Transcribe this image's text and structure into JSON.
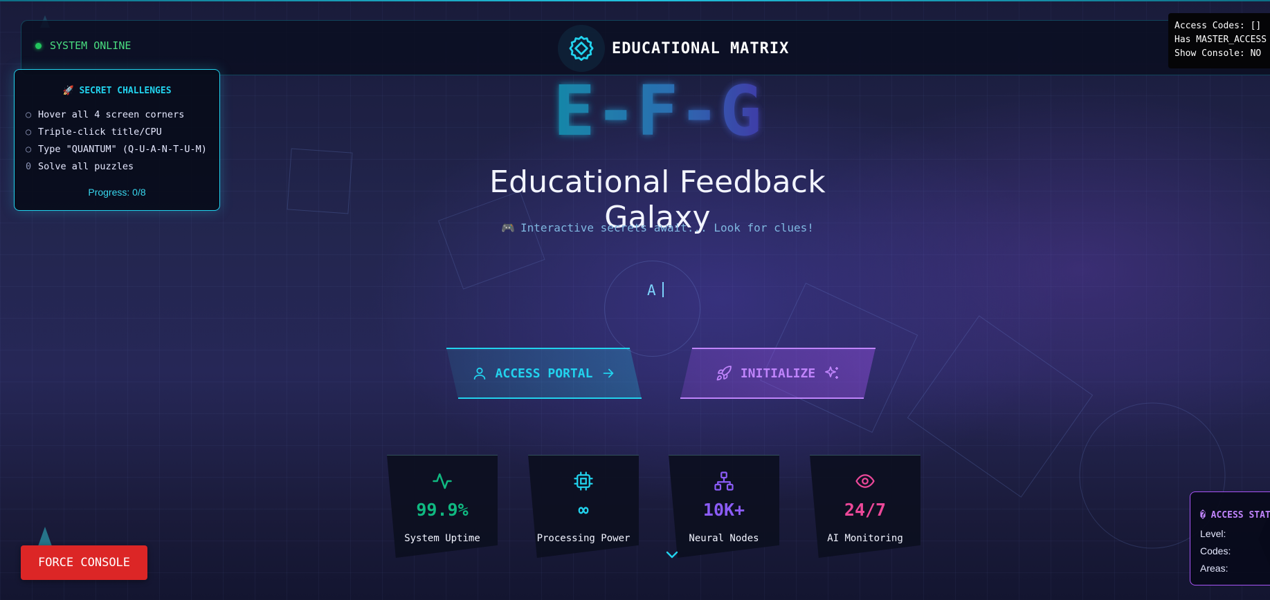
{
  "header": {
    "status_text": "SYSTEM ONLINE",
    "brand_title": "EDUCATIONAL MATRIX",
    "brand_icon": "gear-chip-icon"
  },
  "debug": {
    "line1": "Access Codes: []",
    "line2": "Has MASTER_ACCESS",
    "line3": "Show Console: NO"
  },
  "challenges": {
    "icon": "🚀",
    "title": "SECRET CHALLENGES",
    "items": [
      {
        "mark": "○",
        "text": "Hover all 4 screen corners"
      },
      {
        "mark": "○",
        "text": "Triple-click title/CPU"
      },
      {
        "mark": "○",
        "text": "Type \"QUANTUM\" (Q-U-A-N-T-U-M)"
      },
      {
        "mark": "0",
        "text": "Solve all puzzles"
      }
    ],
    "progress": "Progress: 0/8"
  },
  "hero": {
    "logo_text": "E-F-G",
    "subtitle": "Educational Feedback Galaxy",
    "hint_icon": "🎮",
    "hint": "Interactive secrets await... Look for clues!",
    "typing_text": "A"
  },
  "buttons": {
    "access_label": "ACCESS PORTAL",
    "init_label": "INITIALIZE"
  },
  "stats": [
    {
      "value": "99.9%",
      "label": "System Uptime",
      "icon": "activity-icon",
      "color": "#10b981"
    },
    {
      "value": "∞",
      "label": "Processing Power",
      "icon": "cpu-icon",
      "color": "#22d3ee"
    },
    {
      "value": "10K+",
      "label": "Neural Nodes",
      "icon": "network-icon",
      "color": "#8b5cf6"
    },
    {
      "value": "24/7",
      "label": "AI Monitoring",
      "icon": "eye-icon",
      "color": "#ec4899"
    }
  ],
  "force_console": "FORCE CONSOLE",
  "access_status": {
    "icon": "�",
    "title": "ACCESS STATUS",
    "level_label": "Level:",
    "codes_label": "Codes:",
    "areas_label": "Areas:"
  },
  "colors": {
    "cyan": "#22d3ee",
    "purple": "#a855f7",
    "green": "#22c55e",
    "red": "#dc2626"
  }
}
